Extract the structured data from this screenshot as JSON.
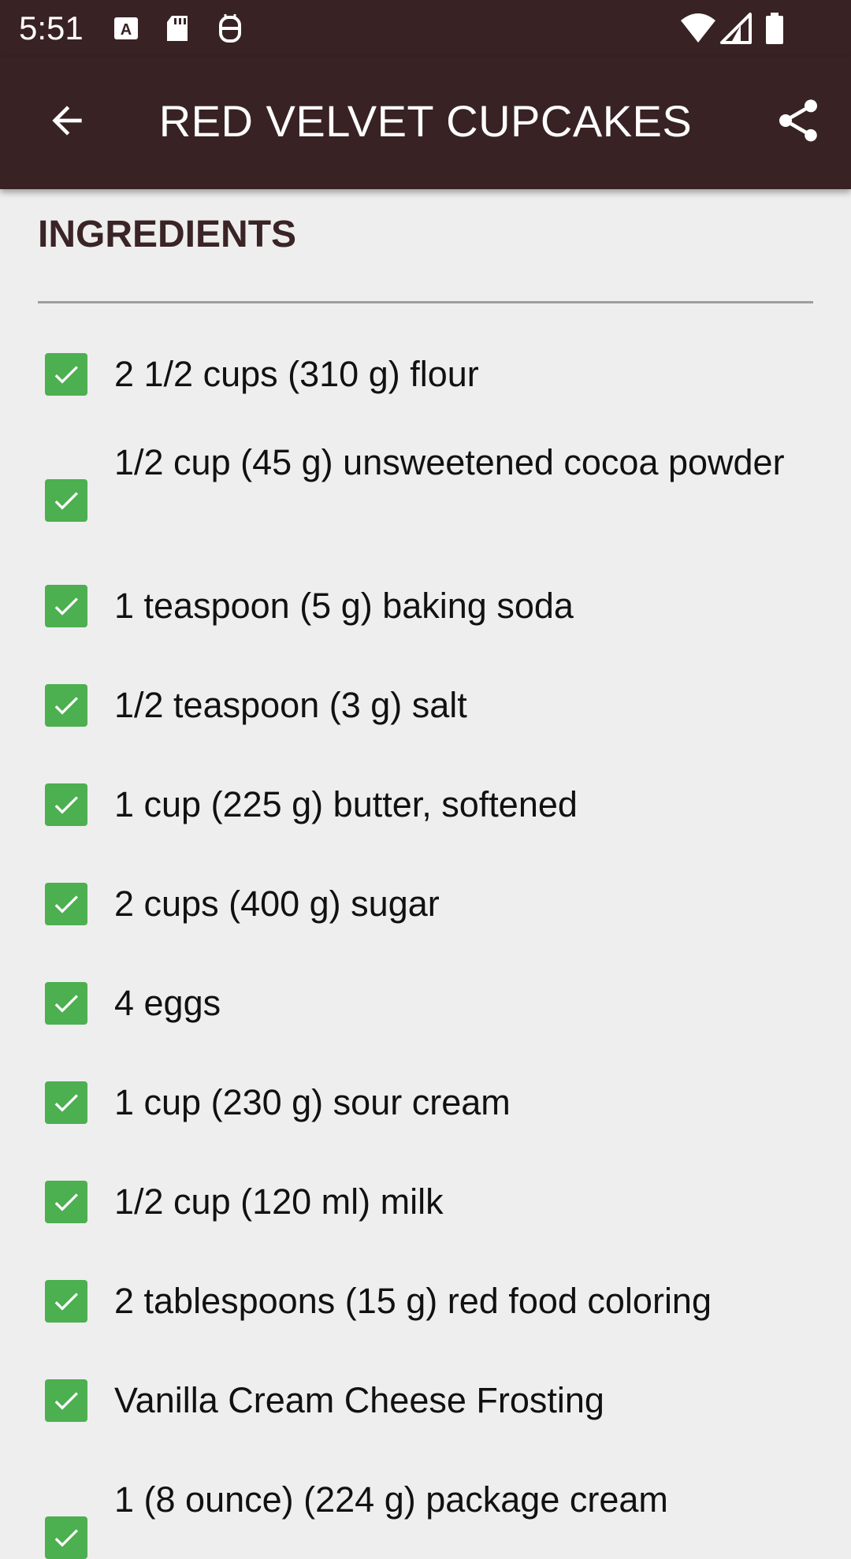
{
  "status_bar": {
    "time": "5:51"
  },
  "app_bar": {
    "title": "RED VELVET CUPCAKES"
  },
  "section": {
    "title": "INGREDIENTS"
  },
  "ingredients": [
    {
      "text": "2 1/2 cups (310 g) flour",
      "checked": true
    },
    {
      "text": "1/2 cup (45 g) unsweetened cocoa powder",
      "checked": true
    },
    {
      "text": "1 teaspoon (5 g) baking soda",
      "checked": true
    },
    {
      "text": "1/2 teaspoon (3 g) salt",
      "checked": true
    },
    {
      "text": "1 cup (225 g) butter, softened",
      "checked": true
    },
    {
      "text": "2 cups (400 g) sugar",
      "checked": true
    },
    {
      "text": "4 eggs",
      "checked": true
    },
    {
      "text": "1 cup (230 g) sour cream",
      "checked": true
    },
    {
      "text": "1/2 cup (120 ml) milk",
      "checked": true
    },
    {
      "text": "2 tablespoons (15 g) red food coloring",
      "checked": true
    },
    {
      "text": "Vanilla Cream Cheese Frosting",
      "checked": true
    },
    {
      "text": "1 (8 ounce) (224 g) package cream",
      "checked": true
    }
  ],
  "colors": {
    "app_bar": "#382224",
    "checkbox": "#4caf50",
    "background": "#eeeeee"
  }
}
